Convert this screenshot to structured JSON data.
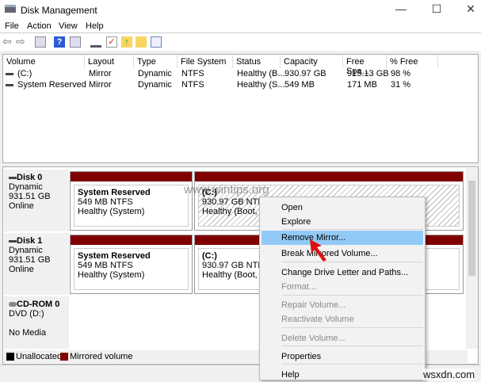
{
  "window": {
    "title": "Disk Management",
    "minimize": "—",
    "maximize": "☐",
    "close": "✕"
  },
  "menu": [
    "File",
    "Action",
    "View",
    "Help"
  ],
  "toolbar_icons": [
    "back-icon",
    "forward-icon",
    "console-tree-icon",
    "help-icon",
    "action-pane-icon",
    "connect-icon",
    "checklist-icon",
    "folder-up-icon",
    "folder-search-icon",
    "properties-icon"
  ],
  "table": {
    "columns": [
      "Volume",
      "Layout",
      "Type",
      "File System",
      "Status",
      "Capacity",
      "Free Spa...",
      "% Free"
    ],
    "rows": [
      [
        "(C:)",
        "Mirror",
        "Dynamic",
        "NTFS",
        "Healthy (B...",
        "930.97 GB",
        "915.13 GB",
        "98 %"
      ],
      [
        "System Reserved",
        "Mirror",
        "Dynamic",
        "NTFS",
        "Healthy (S...",
        "549 MB",
        "171 MB",
        "31 %"
      ]
    ]
  },
  "disks": [
    {
      "name": "Disk 0",
      "type": "Dynamic",
      "size": "931.51 GB",
      "state": "Online",
      "parts": [
        {
          "name": "System Reserved",
          "size": "549 MB NTFS",
          "status": "Healthy (System)"
        },
        {
          "name": "(C:)",
          "size": "930.97 GB NTFS",
          "status": "Healthy (Boot, Page"
        }
      ]
    },
    {
      "name": "Disk 1",
      "type": "Dynamic",
      "size": "931.51 GB",
      "state": "Online",
      "parts": [
        {
          "name": "System Reserved",
          "size": "549 MB NTFS",
          "status": "Healthy (System)"
        },
        {
          "name": "(C:)",
          "size": "930.97 GB NTFS",
          "status": "Healthy (Boot, Page"
        }
      ]
    },
    {
      "name": "CD-ROM 0",
      "type": "DVD (D:)",
      "state": "No Media"
    }
  ],
  "legend": [
    {
      "label": "Unallocated",
      "color": "#000000"
    },
    {
      "label": "Mirrored volume",
      "color": "#800000"
    }
  ],
  "context_menu": {
    "open": "Open",
    "explore": "Explore",
    "remove_mirror": "Remove Mirror...",
    "break": "Break Mirrored Volume...",
    "change": "Change Drive Letter and Paths...",
    "format": "Format...",
    "repair": "Repair Volume...",
    "reactivate": "Reactivate Volume",
    "delete": "Delete Volume...",
    "properties": "Properties",
    "help": "Help"
  },
  "watermarks": {
    "top": "www.wintips.org",
    "bottom": "wsxdn.com"
  }
}
